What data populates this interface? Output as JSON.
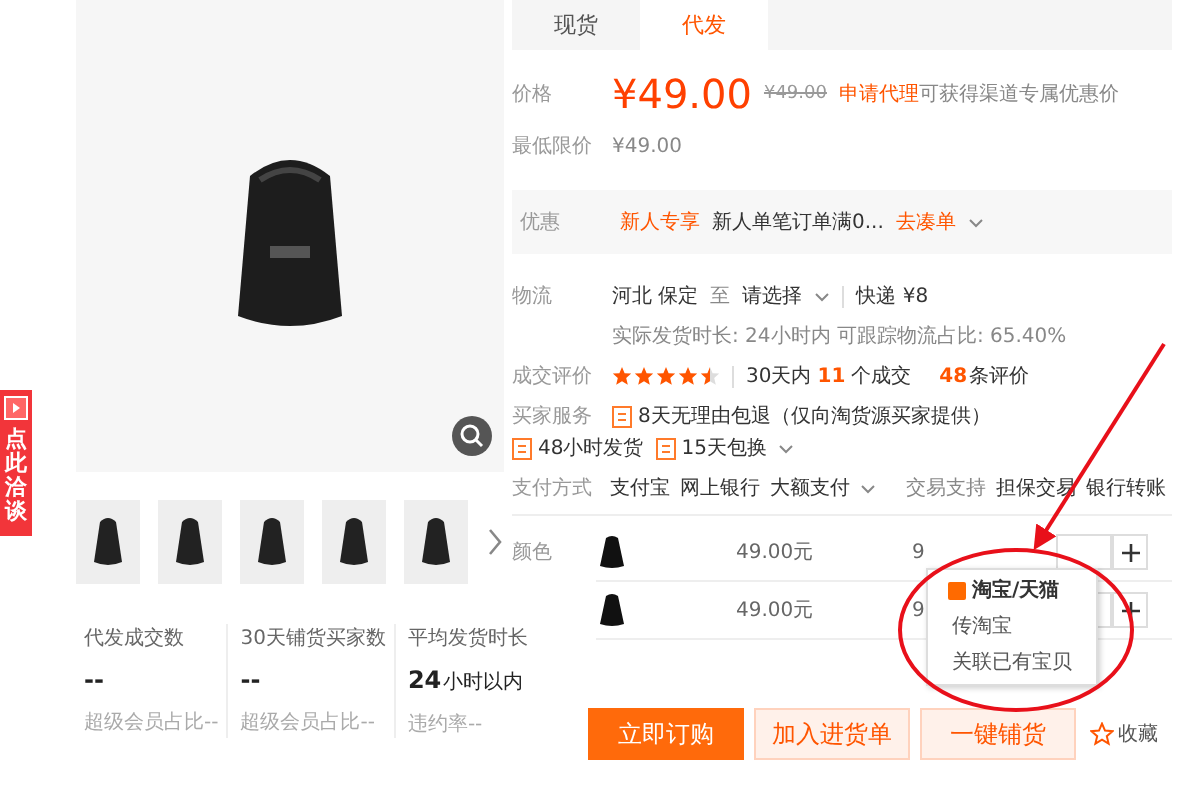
{
  "side_tab": {
    "label": "点此洽谈"
  },
  "stats": [
    {
      "label": "代发成交数",
      "value": "--",
      "note": "超级会员占比--"
    },
    {
      "label": "30天铺货买家数",
      "value": "--",
      "note": "超级会员占比--"
    },
    {
      "label": "平均发货时长",
      "value": "24",
      "unit": "小时以内",
      "note": "违约率--"
    }
  ],
  "tabs": [
    {
      "label": "现货",
      "selected": false
    },
    {
      "label": "代发",
      "selected": true
    }
  ],
  "price": {
    "label": "价格",
    "value": "¥49.00",
    "original": "¥49.00",
    "apply_link": "申请代理",
    "apply_note": "可获得渠道专属优惠价"
  },
  "min_price": {
    "label": "最低限价",
    "value": "¥49.00"
  },
  "promo": {
    "label": "优惠",
    "tag": "新人专享",
    "text": "新人单笔订单满0...",
    "link": "去凑单"
  },
  "logistics": {
    "label": "物流",
    "origin": "河北 保定",
    "to": "至",
    "destination": "请选择",
    "shipping": "快递 ¥8",
    "detail": "实际发货时长: 24小时内   可跟踪物流占比: 65.40%"
  },
  "rating": {
    "label": "成交评价",
    "stars": 4.5,
    "sales_prefix": "30天内",
    "sales_count": "11",
    "sales_suffix": "个成交",
    "reviews_count": "48",
    "reviews_suffix": "条评价"
  },
  "services": {
    "label": "买家服务",
    "items": [
      {
        "text": "8天无理由包退（仅向淘货源买家提供）"
      },
      {
        "text": "48小时发货"
      },
      {
        "text": "15天包换"
      }
    ]
  },
  "payment": {
    "label": "支付方式",
    "methods": [
      "支付宝",
      "网上银行",
      "大额支付"
    ],
    "trade_label": "交易支持",
    "trade": [
      "担保交易",
      "银行转账"
    ]
  },
  "colors": {
    "label": "颜色",
    "rows": [
      {
        "price": "49.00元",
        "stock": "9"
      },
      {
        "price": "49.00元",
        "stock": "9"
      }
    ]
  },
  "popup": {
    "items": [
      {
        "kind": "header",
        "text": "淘宝/天猫"
      },
      {
        "kind": "option",
        "text": "传淘宝"
      },
      {
        "kind": "option",
        "text": "关联已有宝贝"
      }
    ]
  },
  "buttons": [
    {
      "kind": "primary",
      "label": "立即订购"
    },
    {
      "kind": "secondary",
      "label": "加入进货单"
    },
    {
      "kind": "secondary",
      "label": "一键铺货"
    }
  ],
  "favorite": {
    "label": "收藏"
  }
}
